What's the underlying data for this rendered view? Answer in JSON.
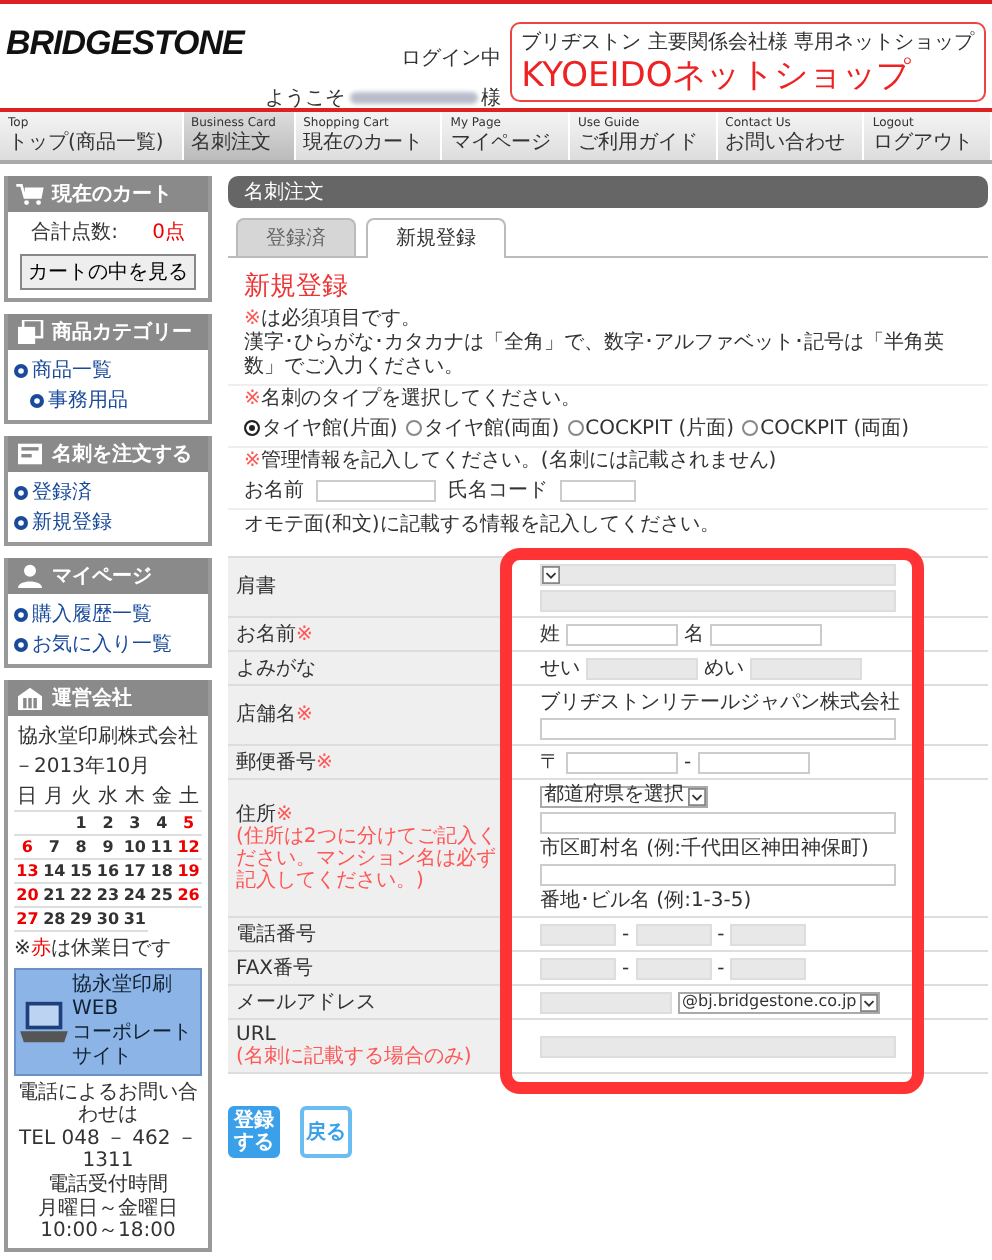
{
  "header": {
    "logo": "BRIDGESTONE",
    "login_status": "ログイン中",
    "welcome": "ようこそ",
    "honorific": "様",
    "shop_badge": {
      "subtitle": "ブリヂストン 主要関係会社様 専用ネットショップ",
      "title": "KYOEIDOネットショップ"
    }
  },
  "nav": [
    {
      "en": "Top",
      "label": "トップ(商品一覧)",
      "selected": false
    },
    {
      "en": "Business Card",
      "label": "名刺注文",
      "selected": true
    },
    {
      "en": "Shopping Cart",
      "label": "現在のカート",
      "selected": false
    },
    {
      "en": "My Page",
      "label": "マイページ",
      "selected": false
    },
    {
      "en": "Use Guide",
      "label": "ご利用ガイド",
      "selected": false
    },
    {
      "en": "Contact Us",
      "label": "お問い合わせ",
      "selected": false
    },
    {
      "en": "Logout",
      "label": "ログアウト",
      "selected": false
    }
  ],
  "sidebar": [
    {
      "kind": "cart",
      "title": "現在のカート",
      "total_label": "合計点数:",
      "total_value": "0点",
      "button": "カートの中を見る"
    },
    {
      "kind": "category",
      "title": "商品カテゴリー",
      "items": [
        {
          "label": "商品一覧",
          "children": [
            {
              "label": "事務用品"
            }
          ]
        }
      ]
    },
    {
      "kind": "order",
      "title": "名刺を注文する",
      "items": [
        {
          "label": "登録済"
        },
        {
          "label": "新規登録"
        }
      ]
    },
    {
      "kind": "mypage",
      "title": "マイページ",
      "items": [
        {
          "label": "購入履歴一覧"
        },
        {
          "label": "お気に入り一覧"
        }
      ]
    },
    {
      "kind": "company",
      "title": "運営会社",
      "company": "協永堂印刷株式会社",
      "month": "－2013年10月",
      "weekdays": [
        "日",
        "月",
        "火",
        "水",
        "木",
        "金",
        "土"
      ],
      "weeks": [
        [
          {
            "d": "1",
            "holiday": false
          },
          {
            "d": "2",
            "holiday": false
          },
          {
            "d": "3",
            "holiday": false
          },
          {
            "d": "4",
            "holiday": false
          },
          {
            "d": "5",
            "holiday": true
          }
        ],
        [
          {
            "d": "6",
            "holiday": true
          },
          {
            "d": "7",
            "holiday": false
          },
          {
            "d": "8",
            "holiday": false
          },
          {
            "d": "9",
            "holiday": false
          },
          {
            "d": "10",
            "holiday": false
          },
          {
            "d": "11",
            "holiday": false
          },
          {
            "d": "12",
            "holiday": true
          }
        ],
        [
          {
            "d": "13",
            "holiday": true
          },
          {
            "d": "14",
            "holiday": false
          },
          {
            "d": "15",
            "holiday": false
          },
          {
            "d": "16",
            "holiday": false
          },
          {
            "d": "17",
            "holiday": false
          },
          {
            "d": "18",
            "holiday": false
          },
          {
            "d": "19",
            "holiday": true
          }
        ],
        [
          {
            "d": "20",
            "holiday": true
          },
          {
            "d": "21",
            "holiday": false
          },
          {
            "d": "22",
            "holiday": false
          },
          {
            "d": "23",
            "holiday": false
          },
          {
            "d": "24",
            "holiday": false
          },
          {
            "d": "25",
            "holiday": false
          },
          {
            "d": "26",
            "holiday": true
          }
        ],
        [
          {
            "d": "27",
            "holiday": true
          },
          {
            "d": "28",
            "holiday": false
          },
          {
            "d": "29",
            "holiday": false
          },
          {
            "d": "30",
            "holiday": false
          },
          {
            "d": "31",
            "holiday": false
          }
        ]
      ],
      "note": {
        "prefix": "※",
        "highlight": "赤",
        "suffix": "は休業日です"
      },
      "banner": [
        "協永堂印刷 WEB",
        "コーポレートサイト"
      ],
      "contact": [
        "電話によるお問い合わせは",
        "TEL 048 － 462 － 1311",
        "電話受付時間",
        "月曜日～金曜日10:00～18:00"
      ]
    }
  ],
  "main": {
    "title": "名刺注文",
    "tabs": [
      {
        "label": "登録済",
        "selected": false
      },
      {
        "label": "新規登録",
        "selected": true
      }
    ],
    "heading": "新規登録",
    "intro": [
      {
        "mark": "※",
        "text": "は必須項目です。"
      },
      {
        "text": "漢字･ひらがな･カタカナは「全角」で、数字･アルファベット･記号は「半角英数」でご入力ください。"
      }
    ],
    "type_prompt": {
      "mark": "※",
      "text": "名刺のタイプを選択してください。"
    },
    "types": [
      {
        "label": "タイヤ館(片面)",
        "selected": true
      },
      {
        "label": "タイヤ館(両面)",
        "selected": false
      },
      {
        "label": "COCKPIT (片面)",
        "selected": false
      },
      {
        "label": "COCKPIT (両面)",
        "selected": false
      }
    ],
    "admin_prompt": {
      "mark": "※",
      "text": "管理情報を記入してください。(名刺には記載されません)"
    },
    "admin_fields": [
      {
        "label": "お名前"
      },
      {
        "label": "氏名コード"
      }
    ],
    "front_prompt": "オモテ面(和文)に記載する情報を記入してください。",
    "rows": [
      {
        "label": "肩書",
        "lines": [
          [
            {
              "kind": "select",
              "disabled": true
            }
          ],
          [
            {
              "kind": "input",
              "disabled": true
            }
          ]
        ]
      },
      {
        "label": "お名前",
        "mark": "※",
        "lines": [
          [
            {
              "kind": "label",
              "text": "姓"
            },
            {
              "kind": "input",
              "disabled": false
            },
            {
              "kind": "label",
              "text": "名"
            },
            {
              "kind": "input",
              "disabled": false
            }
          ]
        ]
      },
      {
        "label": "よみがな",
        "lines": [
          [
            {
              "kind": "label",
              "text": "せい"
            },
            {
              "kind": "input",
              "disabled": true
            },
            {
              "kind": "label",
              "text": "めい"
            },
            {
              "kind": "input",
              "disabled": true
            }
          ]
        ]
      },
      {
        "label": "店舗名",
        "mark": "※",
        "lines": [
          [
            {
              "kind": "label",
              "text": "ブリヂストンリテールジャパン株式会社"
            }
          ],
          [
            {
              "kind": "input",
              "disabled": false
            }
          ]
        ]
      },
      {
        "label": "郵便番号",
        "mark": "※",
        "lines": [
          [
            {
              "kind": "label",
              "text": "〒"
            },
            {
              "kind": "input",
              "disabled": false
            },
            {
              "kind": "label",
              "text": "-"
            },
            {
              "kind": "input",
              "disabled": false
            }
          ]
        ]
      },
      {
        "label": "住所",
        "mark": "※",
        "note": "(住所は2つに分けてご記入ください。マンション名は必ず記入してください。)",
        "lines": [
          [
            {
              "kind": "select",
              "disabled": false,
              "text": "都道府県を選択"
            }
          ],
          [
            {
              "kind": "input",
              "disabled": false
            }
          ],
          [
            {
              "kind": "label",
              "text": "市区町村名 (例:千代田区神田神保町)"
            }
          ],
          [
            {
              "kind": "input",
              "disabled": false
            }
          ],
          [
            {
              "kind": "label",
              "text": "番地･ビル名 (例:1-3-5)"
            }
          ]
        ]
      },
      {
        "label": "電話番号",
        "lines": [
          [
            {
              "kind": "input",
              "disabled": true
            },
            {
              "kind": "label",
              "text": "-"
            },
            {
              "kind": "input",
              "disabled": true
            },
            {
              "kind": "label",
              "text": "-"
            },
            {
              "kind": "input",
              "disabled": true
            }
          ]
        ]
      },
      {
        "label": "FAX番号",
        "lines": [
          [
            {
              "kind": "input",
              "disabled": true
            },
            {
              "kind": "label",
              "text": "-"
            },
            {
              "kind": "input",
              "disabled": true
            },
            {
              "kind": "label",
              "text": "-"
            },
            {
              "kind": "input",
              "disabled": true
            }
          ]
        ]
      },
      {
        "label": "メールアドレス",
        "lines": [
          [
            {
              "kind": "input",
              "disabled": true
            },
            {
              "kind": "select",
              "disabled": false,
              "text": "@bj.bridgestone.co.jp"
            }
          ]
        ]
      },
      {
        "label": "URL",
        "note": "(名刺に記載する場合のみ)",
        "lines": [
          [
            {
              "kind": "input",
              "disabled": true
            }
          ]
        ]
      }
    ],
    "buttons": [
      {
        "kind": "primary",
        "label": "登録する"
      },
      {
        "kind": "secondary",
        "label": "戻る"
      }
    ]
  }
}
